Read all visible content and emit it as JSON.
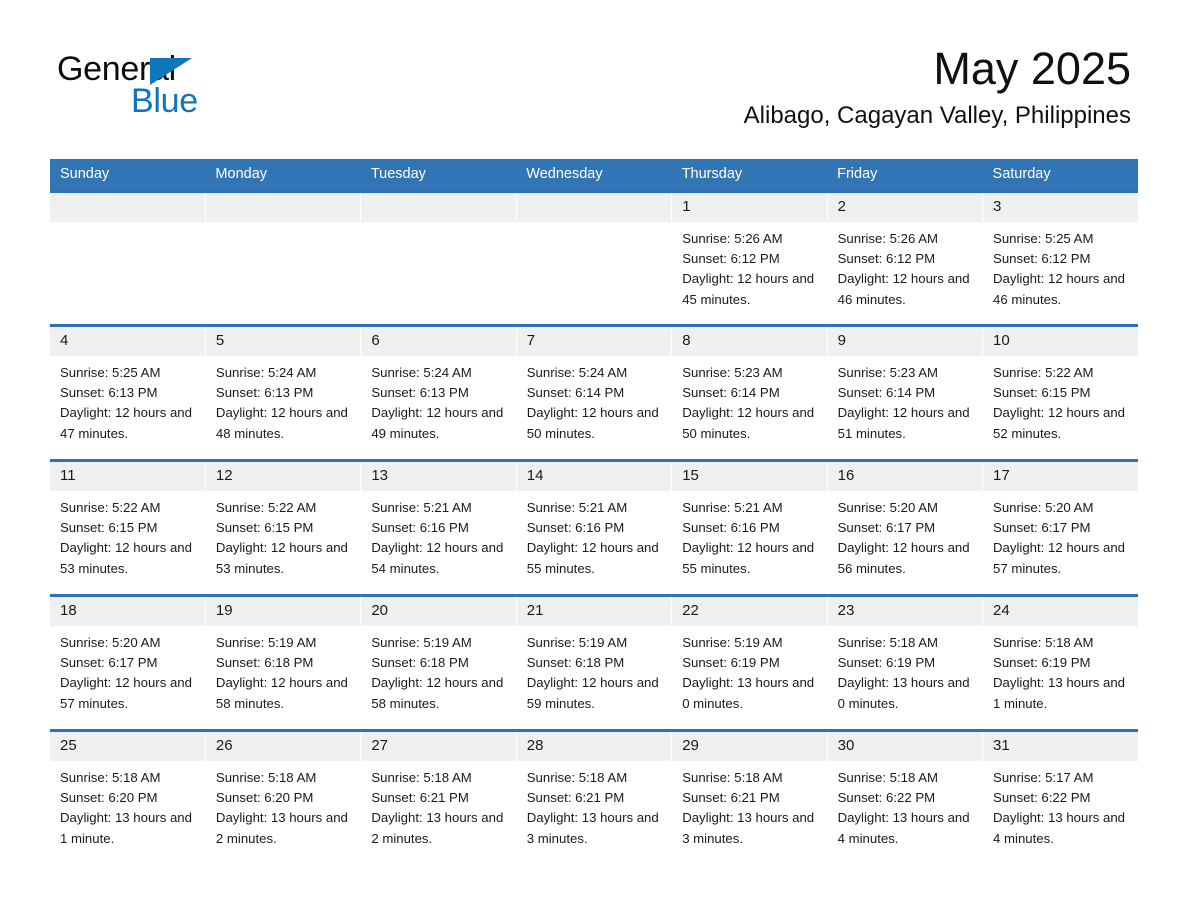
{
  "brand": {
    "name_part1": "General",
    "name_part2": "Blue",
    "accent_color": "#1076bc",
    "logo_icon": "triangle-icon"
  },
  "header": {
    "month_title": "May 2025",
    "location": "Alibago, Cagayan Valley, Philippines"
  },
  "calendar": {
    "header_background": "#3275b5",
    "row_border_color": "#2e71b8",
    "daynum_background": "#f0f0f0",
    "weekday_headers": [
      "Sunday",
      "Monday",
      "Tuesday",
      "Wednesday",
      "Thursday",
      "Friday",
      "Saturday"
    ],
    "weeks": [
      [
        {
          "day": "",
          "empty": true
        },
        {
          "day": "",
          "empty": true
        },
        {
          "day": "",
          "empty": true
        },
        {
          "day": "",
          "empty": true
        },
        {
          "day": "1",
          "sunrise": "Sunrise: 5:26 AM",
          "sunset": "Sunset: 6:12 PM",
          "daylight": "Daylight: 12 hours and 45 minutes."
        },
        {
          "day": "2",
          "sunrise": "Sunrise: 5:26 AM",
          "sunset": "Sunset: 6:12 PM",
          "daylight": "Daylight: 12 hours and 46 minutes."
        },
        {
          "day": "3",
          "sunrise": "Sunrise: 5:25 AM",
          "sunset": "Sunset: 6:12 PM",
          "daylight": "Daylight: 12 hours and 46 minutes."
        }
      ],
      [
        {
          "day": "4",
          "sunrise": "Sunrise: 5:25 AM",
          "sunset": "Sunset: 6:13 PM",
          "daylight": "Daylight: 12 hours and 47 minutes."
        },
        {
          "day": "5",
          "sunrise": "Sunrise: 5:24 AM",
          "sunset": "Sunset: 6:13 PM",
          "daylight": "Daylight: 12 hours and 48 minutes."
        },
        {
          "day": "6",
          "sunrise": "Sunrise: 5:24 AM",
          "sunset": "Sunset: 6:13 PM",
          "daylight": "Daylight: 12 hours and 49 minutes."
        },
        {
          "day": "7",
          "sunrise": "Sunrise: 5:24 AM",
          "sunset": "Sunset: 6:14 PM",
          "daylight": "Daylight: 12 hours and 50 minutes."
        },
        {
          "day": "8",
          "sunrise": "Sunrise: 5:23 AM",
          "sunset": "Sunset: 6:14 PM",
          "daylight": "Daylight: 12 hours and 50 minutes."
        },
        {
          "day": "9",
          "sunrise": "Sunrise: 5:23 AM",
          "sunset": "Sunset: 6:14 PM",
          "daylight": "Daylight: 12 hours and 51 minutes."
        },
        {
          "day": "10",
          "sunrise": "Sunrise: 5:22 AM",
          "sunset": "Sunset: 6:15 PM",
          "daylight": "Daylight: 12 hours and 52 minutes."
        }
      ],
      [
        {
          "day": "11",
          "sunrise": "Sunrise: 5:22 AM",
          "sunset": "Sunset: 6:15 PM",
          "daylight": "Daylight: 12 hours and 53 minutes."
        },
        {
          "day": "12",
          "sunrise": "Sunrise: 5:22 AM",
          "sunset": "Sunset: 6:15 PM",
          "daylight": "Daylight: 12 hours and 53 minutes."
        },
        {
          "day": "13",
          "sunrise": "Sunrise: 5:21 AM",
          "sunset": "Sunset: 6:16 PM",
          "daylight": "Daylight: 12 hours and 54 minutes."
        },
        {
          "day": "14",
          "sunrise": "Sunrise: 5:21 AM",
          "sunset": "Sunset: 6:16 PM",
          "daylight": "Daylight: 12 hours and 55 minutes."
        },
        {
          "day": "15",
          "sunrise": "Sunrise: 5:21 AM",
          "sunset": "Sunset: 6:16 PM",
          "daylight": "Daylight: 12 hours and 55 minutes."
        },
        {
          "day": "16",
          "sunrise": "Sunrise: 5:20 AM",
          "sunset": "Sunset: 6:17 PM",
          "daylight": "Daylight: 12 hours and 56 minutes."
        },
        {
          "day": "17",
          "sunrise": "Sunrise: 5:20 AM",
          "sunset": "Sunset: 6:17 PM",
          "daylight": "Daylight: 12 hours and 57 minutes."
        }
      ],
      [
        {
          "day": "18",
          "sunrise": "Sunrise: 5:20 AM",
          "sunset": "Sunset: 6:17 PM",
          "daylight": "Daylight: 12 hours and 57 minutes."
        },
        {
          "day": "19",
          "sunrise": "Sunrise: 5:19 AM",
          "sunset": "Sunset: 6:18 PM",
          "daylight": "Daylight: 12 hours and 58 minutes."
        },
        {
          "day": "20",
          "sunrise": "Sunrise: 5:19 AM",
          "sunset": "Sunset: 6:18 PM",
          "daylight": "Daylight: 12 hours and 58 minutes."
        },
        {
          "day": "21",
          "sunrise": "Sunrise: 5:19 AM",
          "sunset": "Sunset: 6:18 PM",
          "daylight": "Daylight: 12 hours and 59 minutes."
        },
        {
          "day": "22",
          "sunrise": "Sunrise: 5:19 AM",
          "sunset": "Sunset: 6:19 PM",
          "daylight": "Daylight: 13 hours and 0 minutes."
        },
        {
          "day": "23",
          "sunrise": "Sunrise: 5:18 AM",
          "sunset": "Sunset: 6:19 PM",
          "daylight": "Daylight: 13 hours and 0 minutes."
        },
        {
          "day": "24",
          "sunrise": "Sunrise: 5:18 AM",
          "sunset": "Sunset: 6:19 PM",
          "daylight": "Daylight: 13 hours and 1 minute."
        }
      ],
      [
        {
          "day": "25",
          "sunrise": "Sunrise: 5:18 AM",
          "sunset": "Sunset: 6:20 PM",
          "daylight": "Daylight: 13 hours and 1 minute."
        },
        {
          "day": "26",
          "sunrise": "Sunrise: 5:18 AM",
          "sunset": "Sunset: 6:20 PM",
          "daylight": "Daylight: 13 hours and 2 minutes."
        },
        {
          "day": "27",
          "sunrise": "Sunrise: 5:18 AM",
          "sunset": "Sunset: 6:21 PM",
          "daylight": "Daylight: 13 hours and 2 minutes."
        },
        {
          "day": "28",
          "sunrise": "Sunrise: 5:18 AM",
          "sunset": "Sunset: 6:21 PM",
          "daylight": "Daylight: 13 hours and 3 minutes."
        },
        {
          "day": "29",
          "sunrise": "Sunrise: 5:18 AM",
          "sunset": "Sunset: 6:21 PM",
          "daylight": "Daylight: 13 hours and 3 minutes."
        },
        {
          "day": "30",
          "sunrise": "Sunrise: 5:18 AM",
          "sunset": "Sunset: 6:22 PM",
          "daylight": "Daylight: 13 hours and 4 minutes."
        },
        {
          "day": "31",
          "sunrise": "Sunrise: 5:17 AM",
          "sunset": "Sunset: 6:22 PM",
          "daylight": "Daylight: 13 hours and 4 minutes."
        }
      ]
    ]
  }
}
